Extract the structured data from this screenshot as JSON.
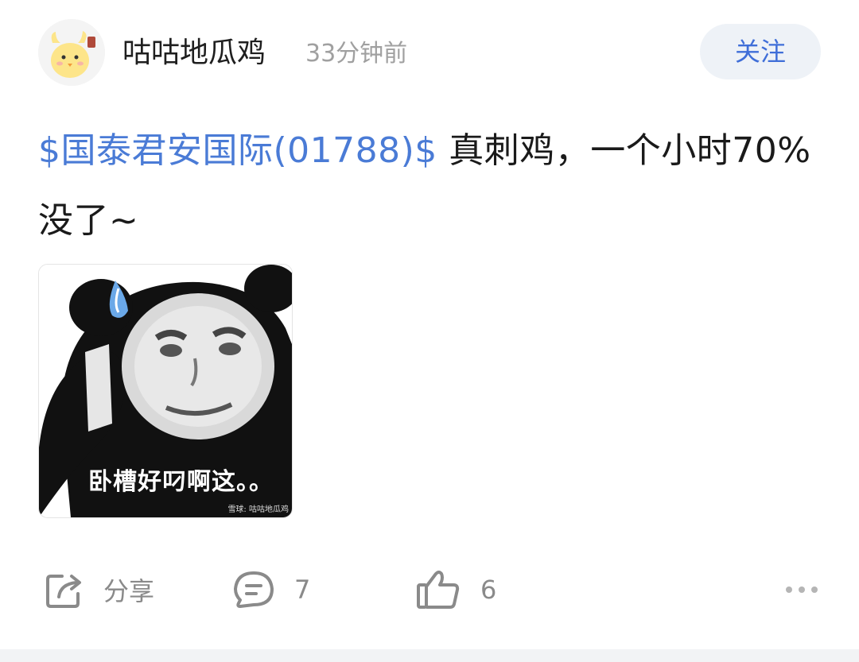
{
  "post": {
    "author": "咕咕地瓜鸡",
    "time": "33分钟前",
    "follow_label": "关注",
    "stock_link": "$国泰君安国际(01788)$",
    "text": " 真刺鸡，一个小时70%没了~"
  },
  "image": {
    "caption": "卧槽好叼啊这。。",
    "watermark": "雪球: 咕咕地瓜鸡"
  },
  "actions": {
    "share_label": "分享",
    "comment_count": "7",
    "like_count": "6"
  },
  "colors": {
    "link": "#4a7bd6",
    "follow_bg": "#eef2f7",
    "icon_gray": "#8a8a8a"
  },
  "icons": [
    "avatar-chick-icon",
    "share-icon",
    "comment-icon",
    "like-icon",
    "more-icon"
  ]
}
